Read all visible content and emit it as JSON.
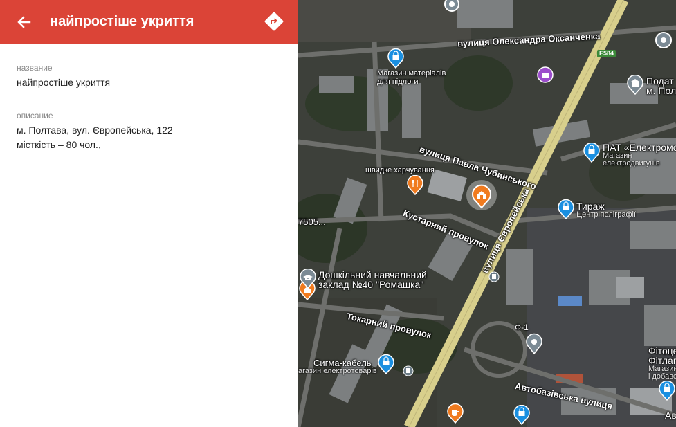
{
  "header": {
    "title": "найпростіше укриття"
  },
  "details": {
    "name_label": "название",
    "name_value": "найпростіше укриття",
    "description_label": "описание",
    "description_line1": "м. Полтава, вул. Європейська, 122",
    "description_line2": "місткість – 80 чол.,"
  },
  "map": {
    "streets": {
      "oleksandra_oksanchenka": "вулиця Олександра Оксанченка",
      "pavla_chubynskoho": "вулиця Павла Чубинського",
      "kustarnyi": "Кустарний провулок",
      "yevropeiska": "вулиця Європейська",
      "tokarnyi": "Токарний провулок",
      "avtobazivska": "Автобазівська вулиця"
    },
    "route_shield": "E584",
    "pois": {
      "flooring_store": "Магазин матеріалів\nдля підлоги",
      "fast_food": "швидке харчування",
      "kindergarten_line1": "Дошкільний навчальний",
      "kindergarten_line2": "заклад №40 \"Ромашка\"",
      "partial_code": "7505...",
      "tax_line1": "Подат",
      "tax_line2": "м. Пол",
      "elektromotor_name": "ПАТ «Електромо",
      "elektromotor_sub1": "Магазин",
      "elektromotor_sub2": "електродвигунів",
      "tyrazh_name": "Тираж",
      "tyrazh_sub": "Центр поліграфії",
      "f1": "Ф-1",
      "sigma_name": "Сигма-кабель",
      "sigma_sub": "агазин електротоварів",
      "fito_line1": "Фітоце",
      "fito_line2": "Фітлаг",
      "fito_line3": "Магазин",
      "fito_line4": "і добавс",
      "edge_av": "Ав"
    },
    "colors": {
      "blue_pin": "#1a8fe0",
      "orange_pin": "#f07b1f",
      "purple_pin": "#9c4dcc",
      "gray_pin": "#7b8a94",
      "header_red": "#db4437"
    }
  }
}
